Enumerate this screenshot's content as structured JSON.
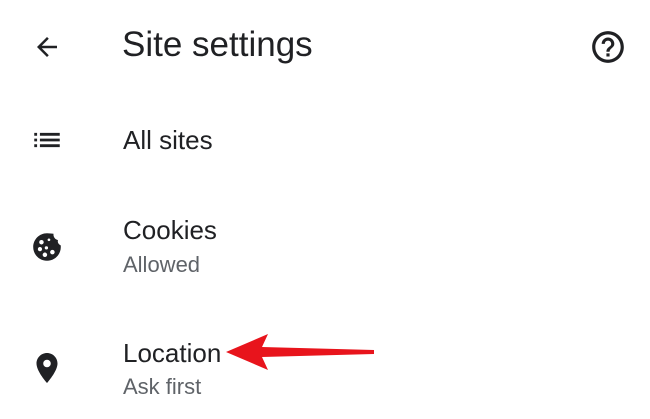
{
  "header": {
    "title": "Site settings",
    "back_icon": "arrow-back-icon",
    "help_icon": "help-circle-icon"
  },
  "items": [
    {
      "title": "All sites",
      "summary": "",
      "icon": "list-icon"
    },
    {
      "title": "Cookies",
      "summary": "Allowed",
      "icon": "cookie-icon"
    },
    {
      "title": "Location",
      "summary": "Ask first",
      "icon": "location-pin-icon"
    }
  ],
  "annotation": {
    "type": "arrow",
    "color": "#e8141c",
    "points_to": "Location"
  },
  "colors": {
    "background": "#ffffff",
    "text_primary": "#202124",
    "text_secondary": "#5f6368",
    "icon": "#202124"
  }
}
